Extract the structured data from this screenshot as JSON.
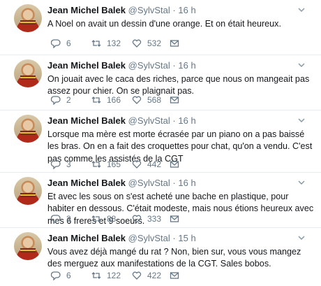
{
  "tweets": [
    {
      "name": "Jean Michel Balek",
      "handle": "@SylvStal",
      "time": "16 h",
      "text": "A Noel on avait un dessin d'une orange. Et on était heureux.",
      "replies": "6",
      "retweets": "132",
      "likes": "532"
    },
    {
      "name": "Jean Michel Balek",
      "handle": "@SylvStal",
      "time": "16 h",
      "text": "On jouait avec le caca des riches, parce que nous on mangeait pas assez pour chier. On se plaignait pas.",
      "replies": "2",
      "retweets": "166",
      "likes": "568"
    },
    {
      "name": "Jean Michel Balek",
      "handle": "@SylvStal",
      "time": "16 h",
      "text": "Lorsque ma mère est morte écrasée par un piano on a pas baissé les bras. On en a fait des croquettes pour chat, qu'on a vendu. C'est pas comme les assistés de la CGT",
      "replies": "3",
      "retweets": "165",
      "likes": "442"
    },
    {
      "name": "Jean Michel Balek",
      "handle": "@SylvStal",
      "time": "16 h",
      "text": "Et avec les sous on s'est acheté une bache en plastique, pour habiter en dessous. C'était modeste, mais nous étions heureux avec mes 6 freres et 9 soeurs.",
      "replies": "3",
      "retweets": "88",
      "likes": "333"
    },
    {
      "name": "Jean Michel Balek",
      "handle": "@SylvStal",
      "time": "15 h",
      "text": "Vous avez déjà mangé du rat ? Non, bien sur, vous vous mangez des merguez aux manifestations de la CGT. Sales bobos.",
      "replies": "6",
      "retweets": "122",
      "likes": "422"
    }
  ],
  "separator": "·",
  "colors": {
    "name": "#14171a",
    "meta": "#657786",
    "divider": "#e6ecf0"
  }
}
